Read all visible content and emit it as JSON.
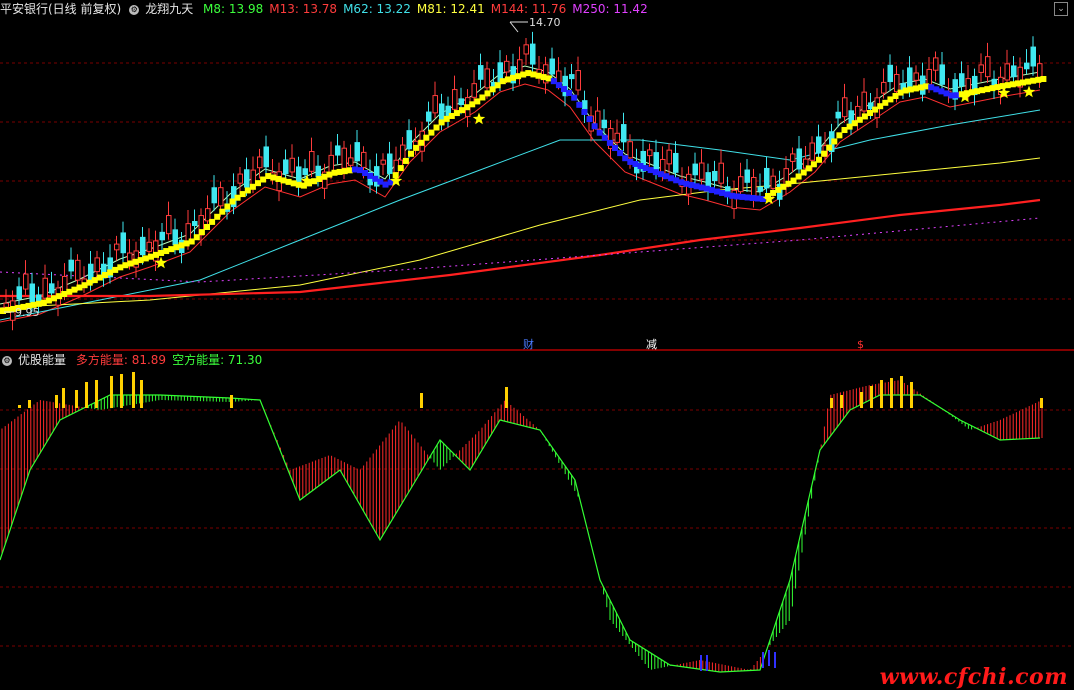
{
  "header": {
    "stock_label": "平安银行(日线 前复权)",
    "indicator_name": "龙翔九天",
    "ma": [
      {
        "label": "M8: 13.98",
        "color": "#3cff3c"
      },
      {
        "label": "M13: 13.78",
        "color": "#ff3c3c"
      },
      {
        "label": "M62: 13.22",
        "color": "#40e0e8"
      },
      {
        "label": "M81: 12.41",
        "color": "#ffff40"
      },
      {
        "label": "M144: 11.76",
        "color": "#ff3c3c"
      },
      {
        "label": "M250: 11.42",
        "color": "#e040ff"
      }
    ]
  },
  "price_annotations": {
    "high": "14.70",
    "low": "9.95"
  },
  "event_markers": [
    {
      "label": "财",
      "color": "#4a7bff"
    },
    {
      "label": "减",
      "color": "#ffffff"
    },
    {
      "label": "$",
      "color": "#ff3030"
    }
  ],
  "sub_panel": {
    "name": "优股能量",
    "bull": {
      "label": "多方能量: 81.89",
      "color": "#ff3c3c"
    },
    "bear": {
      "label": "空方能量: 71.30",
      "color": "#3cff3c"
    }
  },
  "colors": {
    "background": "#000000",
    "grid": "#7a0000",
    "up_candle": "#ff3c3c",
    "down_candle": "#40e8f0",
    "stair_up": "#ffff00",
    "stair_down": "#2020ff",
    "star": "#ffff00"
  },
  "watermark": "www.cfchi.com",
  "corner_icon": "collapse-icon"
}
